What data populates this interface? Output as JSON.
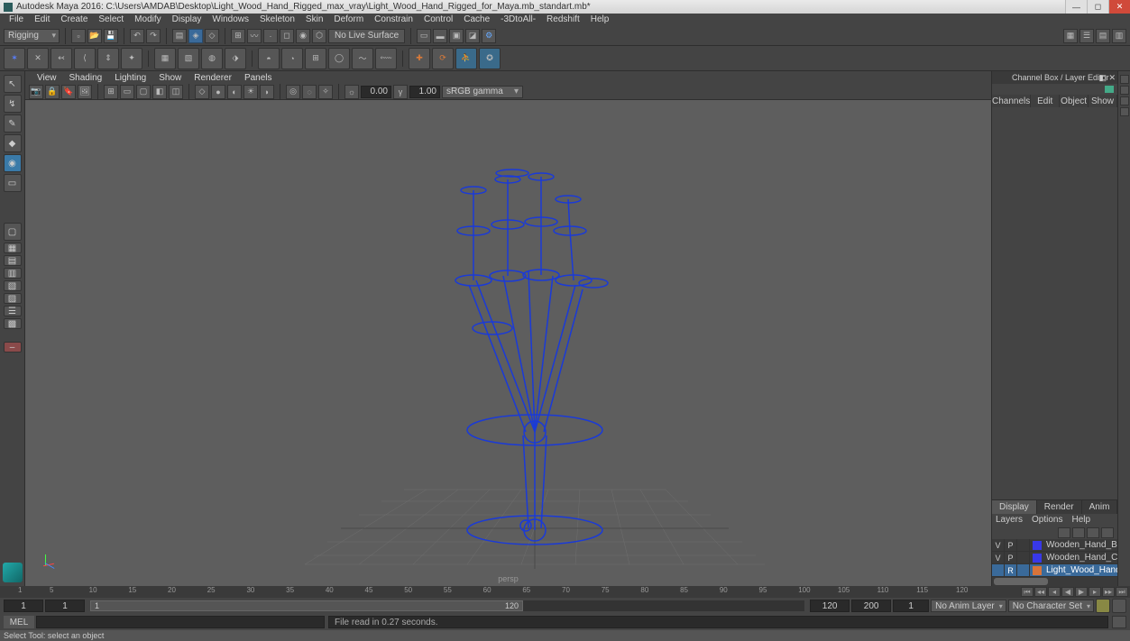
{
  "app": {
    "title": "Autodesk Maya 2016: C:\\Users\\AMDAB\\Desktop\\Light_Wood_Hand_Rigged_max_vray\\Light_Wood_Hand_Rigged_for_Maya.mb_standart.mb*"
  },
  "menu": {
    "items": [
      "File",
      "Edit",
      "Create",
      "Select",
      "Modify",
      "Display",
      "Windows",
      "Skeleton",
      "Skin",
      "Deform",
      "Constrain",
      "Control",
      "Cache",
      "-3DtoAll-",
      "Redshift",
      "Help"
    ]
  },
  "mode": {
    "dropdown": "Rigging",
    "status_text": "No Live Surface"
  },
  "panel_menu": {
    "items": [
      "View",
      "Shading",
      "Lighting",
      "Show",
      "Renderer",
      "Panels"
    ]
  },
  "viewport_toolbar": {
    "exposure": "0.00",
    "gamma": "1.00",
    "colorspace": "sRGB gamma",
    "camera": "persp"
  },
  "channel_box": {
    "header": "Channel Box / Layer Editor",
    "tabs": [
      "Channels",
      "Edit",
      "Object",
      "Show"
    ],
    "layer_tabs": [
      "Display",
      "Render",
      "Anim"
    ],
    "layer_tabs_active": 0,
    "layer_menu": [
      "Layers",
      "Options",
      "Help"
    ],
    "layers": [
      {
        "vis": "V",
        "play": "P",
        "ref": "",
        "color": "#3838e8",
        "name": "Wooden_Hand_Bones"
      },
      {
        "vis": "V",
        "play": "P",
        "ref": "",
        "color": "#3838e8",
        "name": "Wooden_Hand_Contrl"
      },
      {
        "vis": "",
        "play": "R",
        "ref": "",
        "color": "#d8743a",
        "name": "Light_Wood_Hand_Ri"
      }
    ]
  },
  "timeline": {
    "ticks": [
      1,
      5,
      10,
      15,
      20,
      25,
      30,
      35,
      40,
      45,
      50,
      55,
      60,
      65,
      70,
      75,
      80,
      85,
      90,
      95,
      100,
      105,
      110,
      115,
      120
    ],
    "range_start": "1",
    "range_in": "1",
    "range_out": "120",
    "range_end": "200",
    "current_frame": "1",
    "anim_layer": "No Anim Layer",
    "character_set": "No Character Set",
    "slider_left_label": "1",
    "slider_right_label": "120"
  },
  "command": {
    "language": "MEL",
    "output": "File read in 0.27 seconds."
  },
  "helpline": "Select Tool: select an object"
}
